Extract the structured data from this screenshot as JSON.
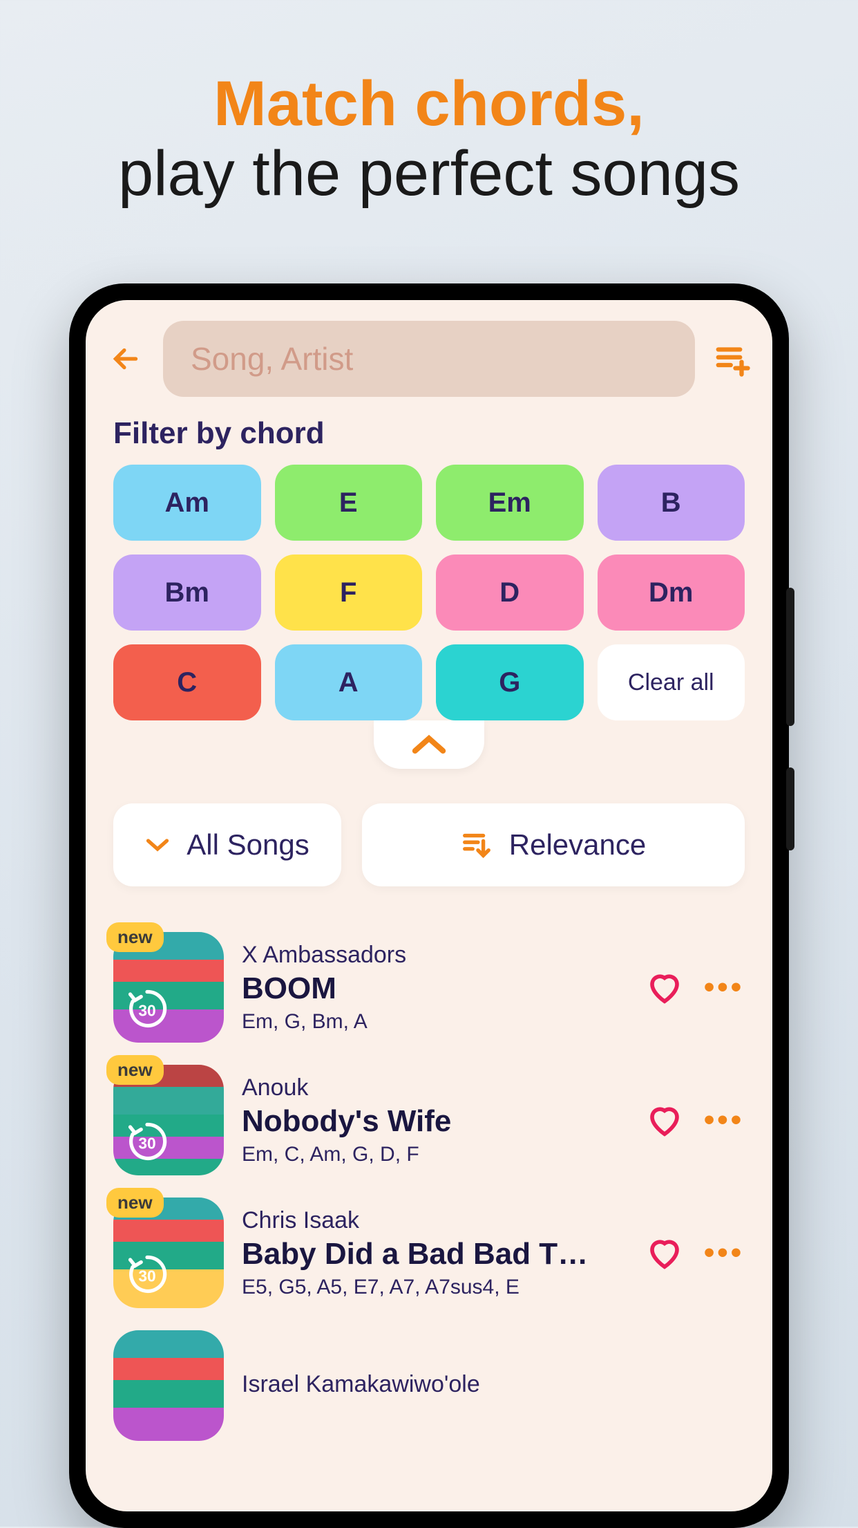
{
  "headline": {
    "line1": "Match chords,",
    "line2": "play the perfect songs"
  },
  "search": {
    "placeholder": "Song, Artist"
  },
  "filter": {
    "label": "Filter by chord",
    "chords": [
      {
        "label": "Am",
        "color": "#7ed6f5"
      },
      {
        "label": "E",
        "color": "#8eec6d"
      },
      {
        "label": "Em",
        "color": "#8eec6d"
      },
      {
        "label": "B",
        "color": "#c4a3f5"
      },
      {
        "label": "Bm",
        "color": "#c4a3f5"
      },
      {
        "label": "F",
        "color": "#ffe24a"
      },
      {
        "label": "D",
        "color": "#fb8ab8"
      },
      {
        "label": "Dm",
        "color": "#fb8ab8"
      },
      {
        "label": "C",
        "color": "#f35f4d"
      },
      {
        "label": "A",
        "color": "#7ed6f5"
      },
      {
        "label": "G",
        "color": "#2bd3d1"
      }
    ],
    "clear_label": "Clear all"
  },
  "sort": {
    "scope": "All Songs",
    "order": "Relevance"
  },
  "songs": [
    {
      "artist": "X Ambassadors",
      "title": "BOOM",
      "chords": "Em, G, Bm, A",
      "new": "new",
      "replay": "30",
      "thumb": "v1"
    },
    {
      "artist": "Anouk",
      "title": "Nobody's Wife",
      "chords": "Em, C, Am, G, D, F",
      "new": "new",
      "replay": "30",
      "thumb": "v2"
    },
    {
      "artist": "Chris Isaak",
      "title": "Baby Did a Bad Bad T…",
      "chords": "E5, G5, A5, E7, A7, A7sus4, E",
      "new": "new",
      "replay": "30",
      "thumb": "v3"
    },
    {
      "artist": "Israel Kamakawiwo'ole",
      "title": "",
      "chords": "",
      "new": "",
      "replay": "",
      "thumb": "v1"
    }
  ]
}
